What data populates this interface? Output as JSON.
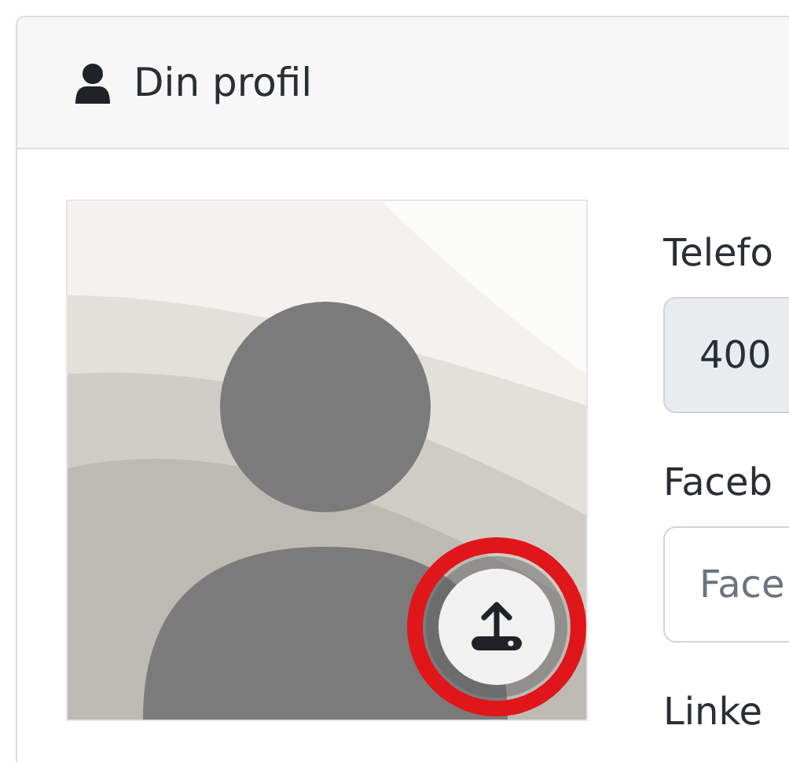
{
  "card": {
    "title": "Din profil"
  },
  "avatar": {
    "upload_button": {
      "highlighted": true
    }
  },
  "fields": [
    {
      "label": "Telefo",
      "value": "400",
      "disabled": true
    },
    {
      "label": "Faceb",
      "placeholder": "Face",
      "disabled": false
    },
    {
      "label": "Linke"
    }
  ]
}
